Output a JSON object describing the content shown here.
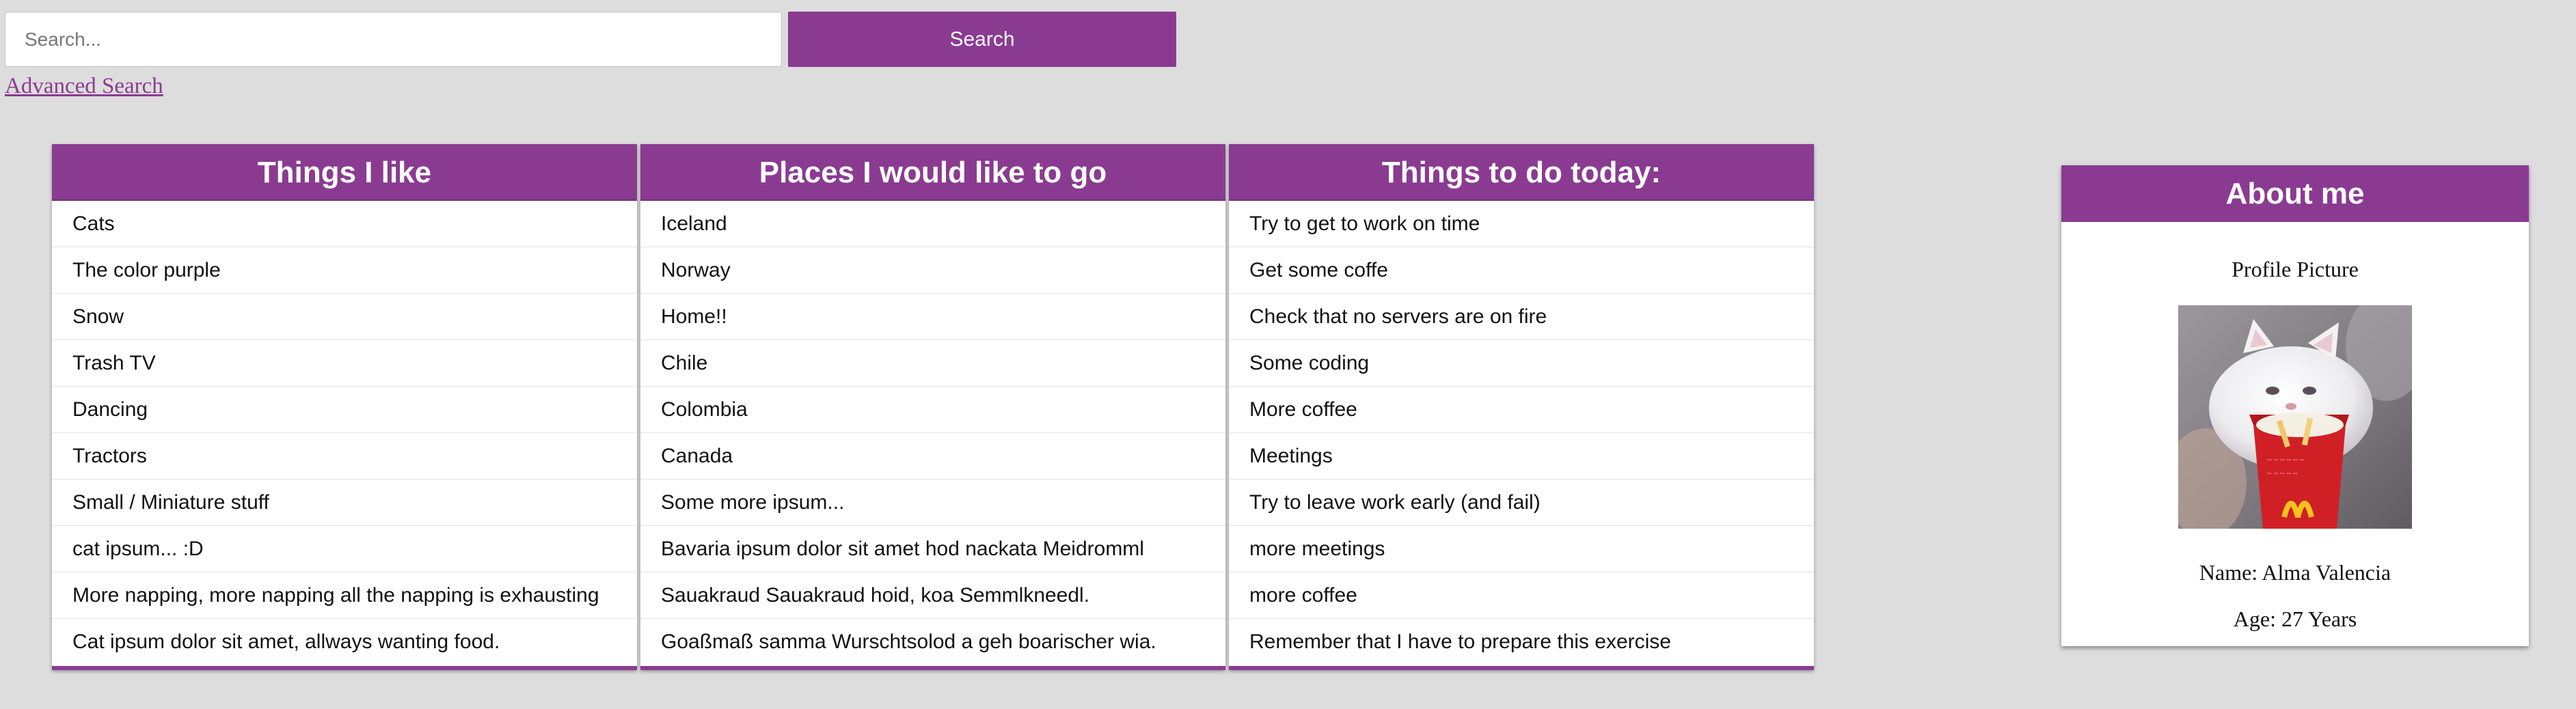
{
  "search": {
    "placeholder": "Search...",
    "button_label": "Search",
    "advanced_link": "Advanced Search"
  },
  "lists": [
    {
      "title": "Things I like",
      "items": [
        "Cats",
        "The color purple",
        "Snow",
        "Trash TV",
        "Dancing",
        "Tractors",
        "Small / Miniature stuff",
        "cat ipsum... :D",
        "More napping, more napping all the napping is exhausting",
        "Cat ipsum dolor sit amet, allways wanting food."
      ]
    },
    {
      "title": "Places I would like to go",
      "items": [
        "Iceland",
        "Norway",
        "Home!!",
        "Chile",
        "Colombia",
        "Canada",
        "Some more ipsum...",
        "Bavaria ipsum dolor sit amet hod nackata Meidromml",
        "Sauakraud Sauakraud hoid, koa Semmlkneedl.",
        "Goaßmaß samma Wurschtsolod a geh boarischer wia."
      ]
    },
    {
      "title": "Things to do today:",
      "items": [
        "Try to get to work on time",
        "Get some coffe",
        "Check that no servers are on fire",
        "Some coding",
        "More coffee",
        "Meetings",
        "Try to leave work early (and fail)",
        "more meetings",
        "more coffee",
        "Remember that I have to prepare this exercise"
      ]
    }
  ],
  "about": {
    "title": "About me",
    "picture_caption": "Profile Picture",
    "name": "Name: Alma Valencia",
    "age": "Age: 27 Years",
    "picture_icon": "kitten-photo",
    "picture_logo_text": "M"
  },
  "colors": {
    "accent": "#8a3b91",
    "background": "#dddddd",
    "panel": "#ffffff"
  }
}
